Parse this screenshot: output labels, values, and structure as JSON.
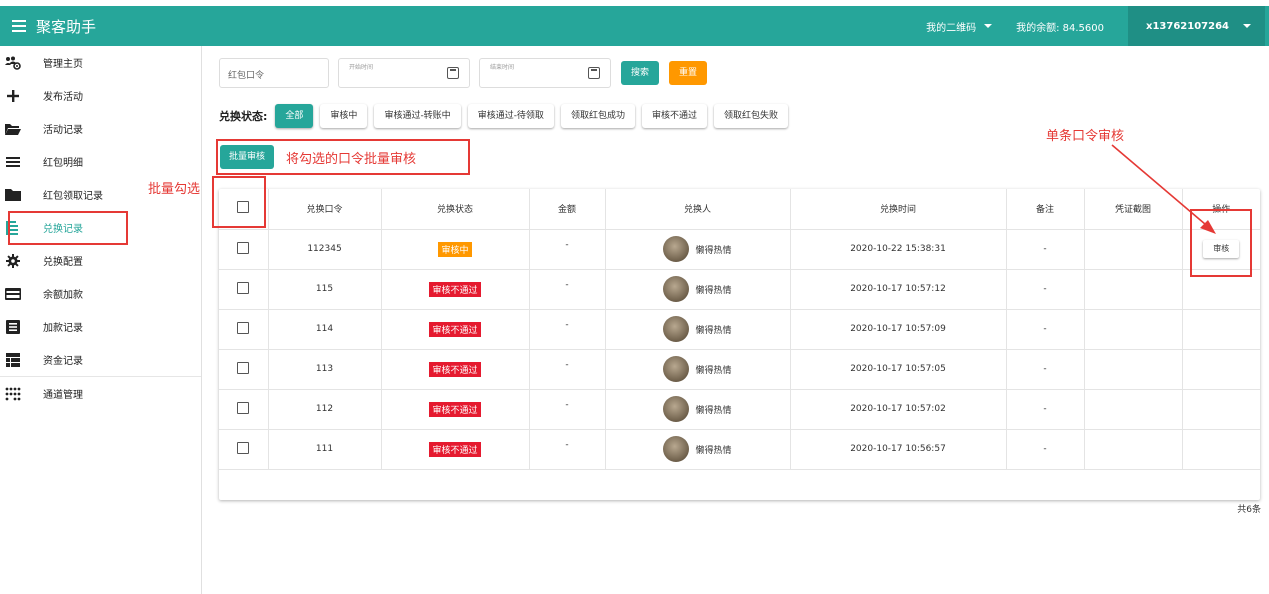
{
  "app": {
    "title": "聚客助手"
  },
  "topbar": {
    "qr_label": "我的二维码",
    "balance_label": "我的余额: 84.5600",
    "user": "x13762107264"
  },
  "sidebar": {
    "items": [
      {
        "label": "管理主页",
        "icon": "users-gear-icon"
      },
      {
        "label": "发布活动",
        "icon": "plus-icon"
      },
      {
        "label": "活动记录",
        "icon": "folder-open-icon"
      },
      {
        "label": "红包明细",
        "icon": "list-icon"
      },
      {
        "label": "红包领取记录",
        "icon": "folder-icon"
      },
      {
        "label": "兑换记录",
        "icon": "list-indent-icon",
        "active": true
      },
      {
        "label": "兑换配置",
        "icon": "gear-icon"
      },
      {
        "label": "余额加款",
        "icon": "card-icon"
      },
      {
        "label": "加款记录",
        "icon": "list-box-icon"
      },
      {
        "label": "资金记录",
        "icon": "table-icon"
      },
      {
        "label": "通道管理",
        "icon": "dots-grid-icon"
      }
    ]
  },
  "filters": {
    "code_placeholder": "红包口令",
    "start_placeholder": "开始时间",
    "end_placeholder": "结束时间",
    "search_label": "搜索",
    "reset_label": "重置"
  },
  "status": {
    "label": "兑换状态:",
    "options": [
      "全部",
      "审核中",
      "审核通过-转账中",
      "审核通过-待领取",
      "领取红包成功",
      "审核不通过",
      "领取红包失败"
    ]
  },
  "batch_label": "批量审核",
  "table": {
    "columns": [
      "兑换口令",
      "兑换状态",
      "金额",
      "兑换人",
      "兑换时间",
      "备注",
      "凭证截图",
      "操作"
    ],
    "rows": [
      {
        "code": "112345",
        "status": "审核中",
        "status_type": "pending",
        "amount": "-",
        "person": "懒得热情",
        "time": "2020-10-22 15:38:31",
        "note": "-",
        "action": "审核"
      },
      {
        "code": "115",
        "status": "审核不通过",
        "status_type": "reject",
        "amount": "-",
        "person": "懒得热情",
        "time": "2020-10-17 10:57:12",
        "note": "-",
        "action": ""
      },
      {
        "code": "114",
        "status": "审核不通过",
        "status_type": "reject",
        "amount": "-",
        "person": "懒得热情",
        "time": "2020-10-17 10:57:09",
        "note": "-",
        "action": ""
      },
      {
        "code": "113",
        "status": "审核不通过",
        "status_type": "reject",
        "amount": "-",
        "person": "懒得热情",
        "time": "2020-10-17 10:57:05",
        "note": "-",
        "action": ""
      },
      {
        "code": "112",
        "status": "审核不通过",
        "status_type": "reject",
        "amount": "-",
        "person": "懒得热情",
        "time": "2020-10-17 10:57:02",
        "note": "-",
        "action": ""
      },
      {
        "code": "111",
        "status": "审核不通过",
        "status_type": "reject",
        "amount": "-",
        "person": "懒得热情",
        "time": "2020-10-17 10:56:57",
        "note": "-",
        "action": ""
      }
    ],
    "total": "共6条"
  },
  "annotations": {
    "batch_select": "批量勾选",
    "batch_review": "将勾选的口令批量审核",
    "single_review": "单条口令审核",
    "color": "#e53935"
  },
  "colors": {
    "brand": "#26a69a",
    "orange": "#ff9800",
    "reject": "#e51a2f"
  }
}
